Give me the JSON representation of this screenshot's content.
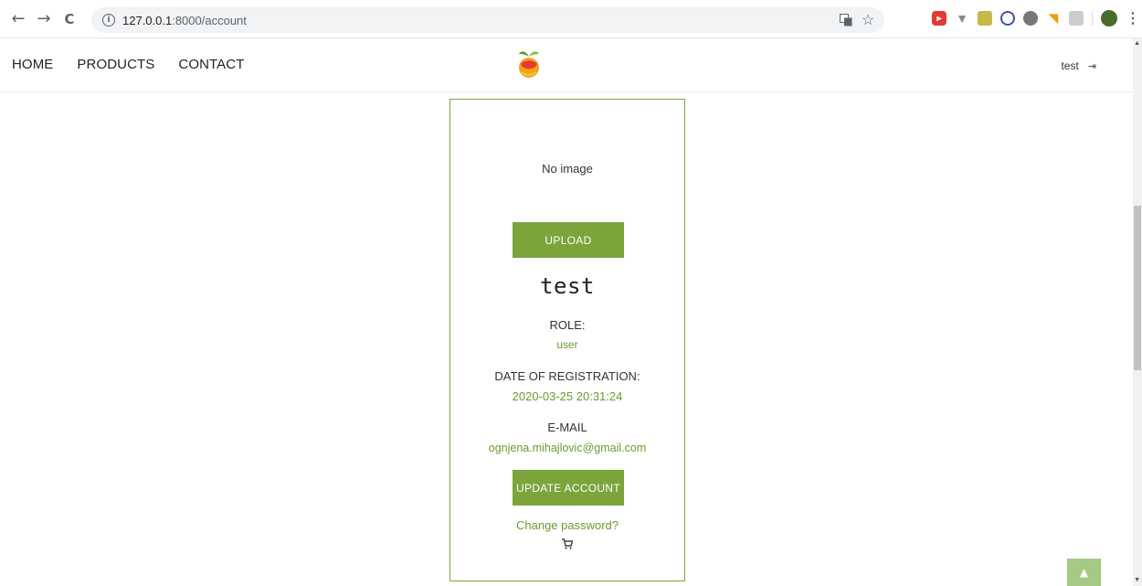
{
  "browser": {
    "url_host": "127.0.0.1",
    "url_path": ":8000/account",
    "back_glyph": "←",
    "forward_glyph": "→",
    "reload_glyph": "C",
    "info_glyph": "i",
    "star_glyph": "☆",
    "menu_glyph": "⋮"
  },
  "nav": {
    "items": [
      "HOME",
      "PRODUCTS",
      "CONTACT"
    ]
  },
  "header": {
    "username": "test",
    "logout_glyph": "⇥"
  },
  "card": {
    "no_image": "No image",
    "upload_label": "UPLOAD",
    "username": "test",
    "role_label": "ROLE:",
    "role_value": "user",
    "date_label": "DATE OF REGISTRATION:",
    "date_value": "2020-03-25 20:31:24",
    "email_label": "E-MAIL",
    "email_value": "ognjena.mihajlovic@gmail.com",
    "update_label": "UPDATE ACCOUNT",
    "change_password": "Change password?"
  },
  "to_top_glyph": "▲",
  "colors": {
    "accent": "#7ba43a",
    "accent_text": "#6d9a2e",
    "border": "#7ea83a",
    "to_top": "#a6c986"
  }
}
